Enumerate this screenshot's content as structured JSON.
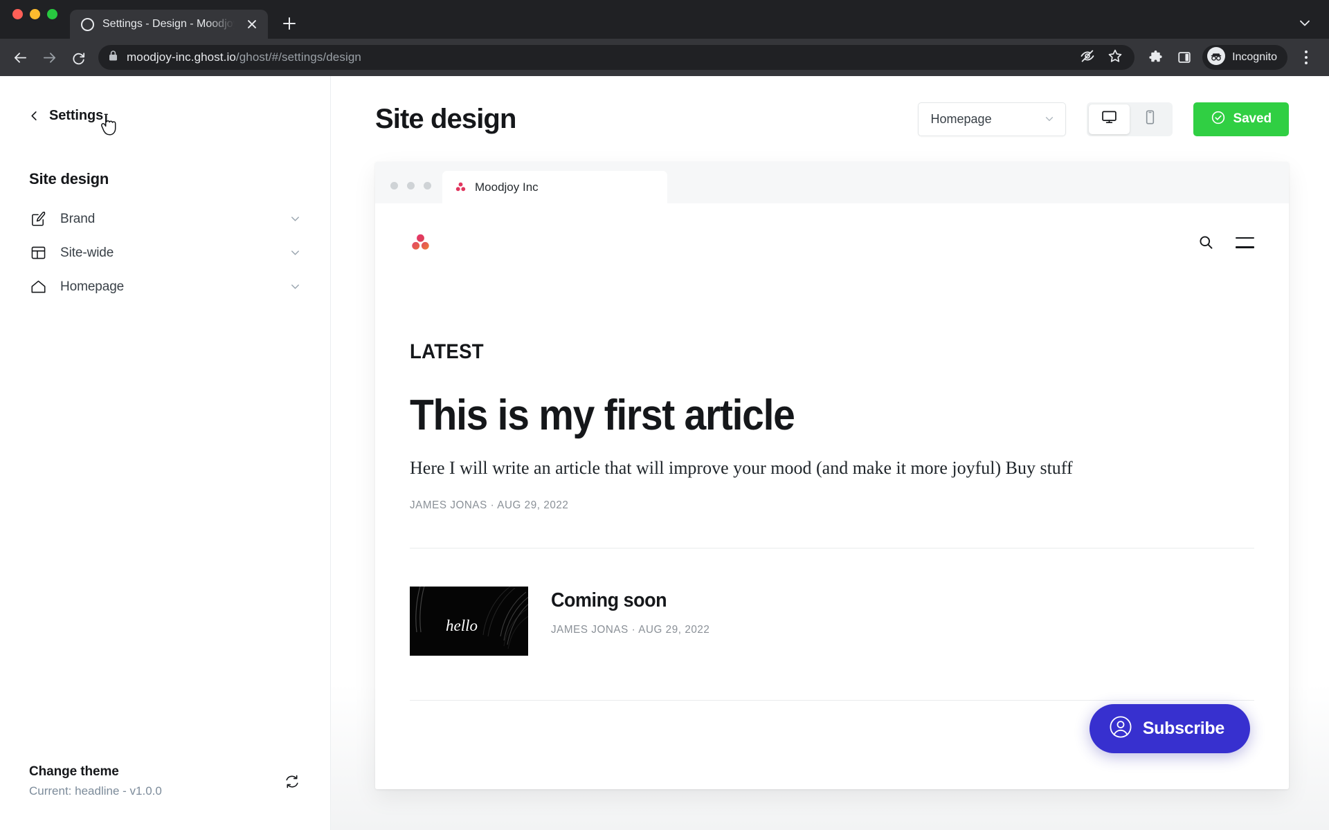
{
  "browser": {
    "tab_title": "Settings - Design - Moodjoy In",
    "favicon_name": "ghost-circle-icon",
    "new_tab_label": "+",
    "url_host": "moodjoy-inc.ghost.io",
    "url_path": "/ghost/#/settings/design",
    "profile_label": "Incognito",
    "icons": {
      "back": "back-arrow-icon",
      "forward": "forward-arrow-icon",
      "reload": "reload-icon",
      "lock": "lock-icon",
      "hidden": "eye-off-icon",
      "bookmark": "star-icon",
      "extensions": "puzzle-piece-icon",
      "sidepanel": "side-panel-icon",
      "menu": "three-dot-menu-icon",
      "window_chevron": "chevron-down-icon"
    }
  },
  "sidebar": {
    "back_label": "Settings",
    "title": "Site design",
    "items": [
      {
        "label": "Brand",
        "icon": "brand-pen-icon"
      },
      {
        "label": "Site-wide",
        "icon": "layout-icon"
      },
      {
        "label": "Homepage",
        "icon": "home-icon"
      }
    ],
    "theme": {
      "title": "Change theme",
      "current": "Current: headline - v1.0.0",
      "refresh_icon": "refresh-icon"
    }
  },
  "header": {
    "title": "Site design",
    "page_select": {
      "value": "Homepage",
      "chevron": "chevron-down-icon"
    },
    "device_toggle": [
      {
        "name": "desktop",
        "icon": "desktop-icon",
        "active": true
      },
      {
        "name": "mobile",
        "icon": "mobile-icon",
        "active": false
      }
    ],
    "save_button": {
      "label": "Saved",
      "icon": "check-circle-icon",
      "color": "#30cf43"
    }
  },
  "preview": {
    "chrome": {
      "tab_title": "Moodjoy Inc",
      "favicon": "moodjoy-dots-icon"
    },
    "site": {
      "logo": "moodjoy-three-dots-logo",
      "search_icon": "search-icon",
      "menu_icon": "hamburger-icon",
      "section_label": "LATEST",
      "featured": {
        "title": "This is my first article",
        "excerpt": "Here I will write an article that will improve your mood (and make it more joyful) Buy stuff",
        "author": "JAMES JONAS",
        "separator": "·",
        "date": "AUG 29, 2022"
      },
      "posts": [
        {
          "title": "Coming soon",
          "author": "JAMES JONAS",
          "separator": "·",
          "date": "AUG 29, 2022",
          "thumb_word": "hello"
        }
      ],
      "subscribe": {
        "label": "Subscribe",
        "icon": "user-circle-icon",
        "color": "#3730cf"
      }
    }
  }
}
